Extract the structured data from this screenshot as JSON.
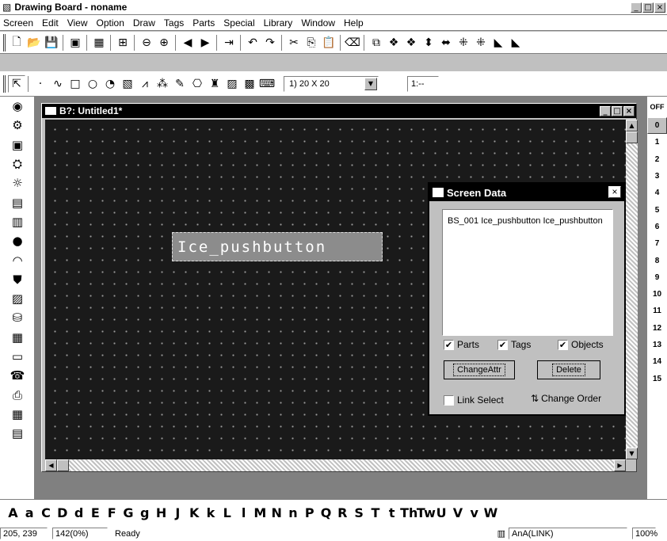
{
  "app": {
    "title": "Drawing Board - noname"
  },
  "window_buttons": {
    "min": "_",
    "max": "□",
    "close": "×"
  },
  "menu": [
    "Screen",
    "Edit",
    "View",
    "Option",
    "Draw",
    "Tags",
    "Parts",
    "Special",
    "Library",
    "Window",
    "Help"
  ],
  "toolbar1_icons": [
    "new-icon",
    "open-icon",
    "save-icon",
    "sep",
    "screen-icon",
    "sep",
    "library-icon",
    "sep",
    "parts-icon",
    "sep",
    "zoom-out-icon",
    "zoom-in-icon",
    "sep",
    "prev-icon",
    "next-icon",
    "sep",
    "jump-icon",
    "sep",
    "undo-icon",
    "redo-icon",
    "sep",
    "cut-icon",
    "copy-icon",
    "paste-icon",
    "sep",
    "erase-icon",
    "sep",
    "group-icon",
    "ungroup-icon",
    "ungroup2-icon",
    "vflip-icon",
    "hflip-icon",
    "align-icon",
    "align2-icon",
    "bring-front-icon",
    "send-back-icon"
  ],
  "toolbar1_glyphs": {
    "new-icon": "🗋",
    "open-icon": "📂",
    "save-icon": "💾",
    "screen-icon": "▣",
    "library-icon": "▦",
    "parts-icon": "⊞",
    "zoom-out-icon": "⊖",
    "zoom-in-icon": "⊕",
    "prev-icon": "◀",
    "next-icon": "▶",
    "jump-icon": "⇥",
    "undo-icon": "↶",
    "redo-icon": "↷",
    "cut-icon": "✂",
    "copy-icon": "⎘",
    "paste-icon": "📋",
    "erase-icon": "⌫",
    "group-icon": "⧉",
    "ungroup-icon": "❖",
    "ungroup2-icon": "❖",
    "vflip-icon": "⬍",
    "hflip-icon": "⬌",
    "align-icon": "⁜",
    "align2-icon": "⁜",
    "bring-front-icon": "◣",
    "send-back-icon": "◣"
  },
  "toolbar2_icons": {
    "pointer": "⇱",
    "dot": "·",
    "line": "∿",
    "rect": "□",
    "circle": "○",
    "arc": "◔",
    "fill": "▧",
    "polyline": "⩘",
    "scatter": "⁂",
    "pen": "✎",
    "poly2": "⎔",
    "stamp": "♜",
    "bitmap": "▨",
    "frame": "▩",
    "text": "⌨"
  },
  "grid_select": {
    "value": "1) 20 X 20"
  },
  "right_select": {
    "value": "1:--"
  },
  "left_tools": [
    "lamp-icon",
    "switch-icon",
    "keypad-icon",
    "gear-icon",
    "bulb-icon",
    "stack-icon",
    "bargraph-icon",
    "circle-icon",
    "meter-icon",
    "shield-icon",
    "image-icon",
    "trend-icon",
    "matrix-icon",
    "display-icon",
    "alarm-icon",
    "printer-icon",
    "table-icon",
    "calendar-icon"
  ],
  "left_glyphs": [
    "◉",
    "⚙",
    "▣",
    "⛭",
    "☼",
    "▤",
    "▥",
    "●",
    "◠",
    "⛊",
    "▨",
    "⛁",
    "▦",
    "▭",
    "☎",
    "⎙",
    "▦",
    "▤"
  ],
  "child": {
    "title": "B?: Untitled1*"
  },
  "part": {
    "label": "Ice_pushbutton"
  },
  "screen_data": {
    "title": "Screen Data",
    "list": [
      "BS_001  Ice_pushbutton  Ice_pushbutton"
    ],
    "parts": "Parts",
    "tags": "Tags",
    "objects": "Objects",
    "change_attr": "ChangeAttr",
    "delete": "Delete",
    "link_select": "Link Select",
    "change_order": "Change Order"
  },
  "right_panel": {
    "header": "OFF",
    "items": [
      "0",
      "1",
      "2",
      "3",
      "4",
      "5",
      "6",
      "7",
      "8",
      "9",
      "10",
      "11",
      "12",
      "13",
      "14",
      "15"
    ]
  },
  "charbar": [
    "A",
    "a",
    "C",
    "D",
    "d",
    "E",
    "F",
    "G",
    "g",
    "H",
    "J",
    "K",
    "k",
    "L",
    "l",
    "M",
    "N",
    "n",
    "P",
    "Q",
    "R",
    "S",
    "T",
    "t",
    "Th",
    "Tw",
    "U",
    "V",
    "v",
    "W"
  ],
  "status": {
    "coords": "205, 239",
    "zoom": "142(0%)",
    "msg": "Ready",
    "link": "AnA(LINK)",
    "pct": "100%"
  }
}
